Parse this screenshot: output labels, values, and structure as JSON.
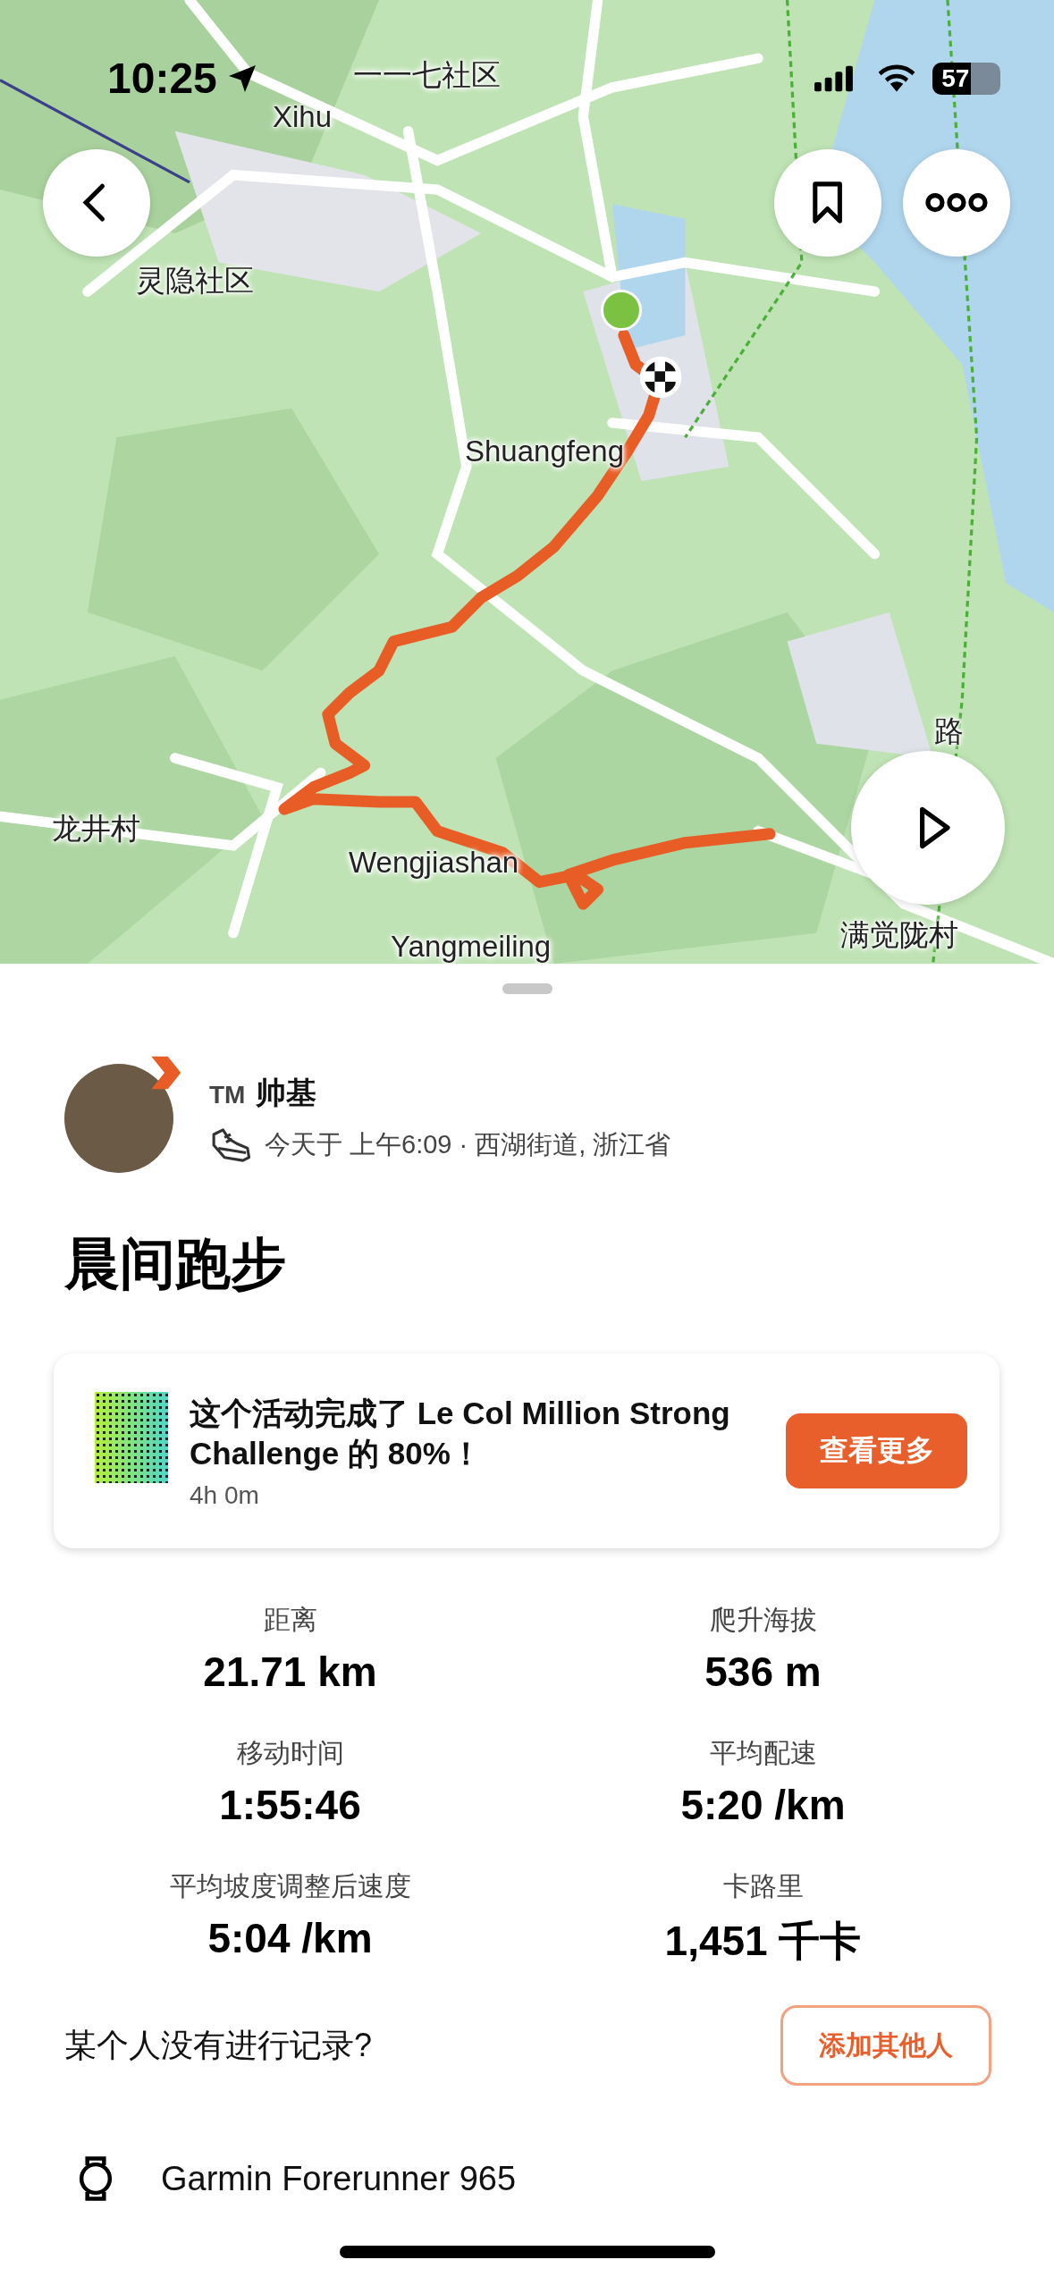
{
  "status_bar": {
    "time": "10:25",
    "battery": "57"
  },
  "map": {
    "labels": [
      {
        "text": "一一七社区"
      },
      {
        "text": "Xihu"
      },
      {
        "text": "灵隐社区"
      },
      {
        "text": "Shuangfeng"
      },
      {
        "text": "路"
      },
      {
        "text": "龙井村"
      },
      {
        "text": "Wengjiashan"
      },
      {
        "text": "Yangmeiling"
      },
      {
        "text": "满觉陇村"
      }
    ]
  },
  "athlete": {
    "badge": "TM",
    "name": "帅基",
    "meta": "今天于 上午6:09 · 西湖街道, 浙江省"
  },
  "title": "晨间跑步",
  "challenge": {
    "text": "这个活动完成了 Le Col Million Strong Challenge 的 80%！",
    "duration": "4h 0m",
    "button": "查看更多"
  },
  "stats": [
    {
      "label": "距离",
      "value": "21.71 km"
    },
    {
      "label": "爬升海拔",
      "value": "536 m"
    },
    {
      "label": "移动时间",
      "value": "1:55:46"
    },
    {
      "label": "平均配速",
      "value": "5:20 /km"
    },
    {
      "label": "平均坡度调整后速度",
      "value": "5:04 /km"
    },
    {
      "label": "卡路里",
      "value": "1,451 千卡"
    }
  ],
  "add_others": {
    "prompt": "某个人没有进行记录?",
    "button": "添加其他人"
  },
  "device": {
    "name": "Garmin Forerunner 965"
  }
}
